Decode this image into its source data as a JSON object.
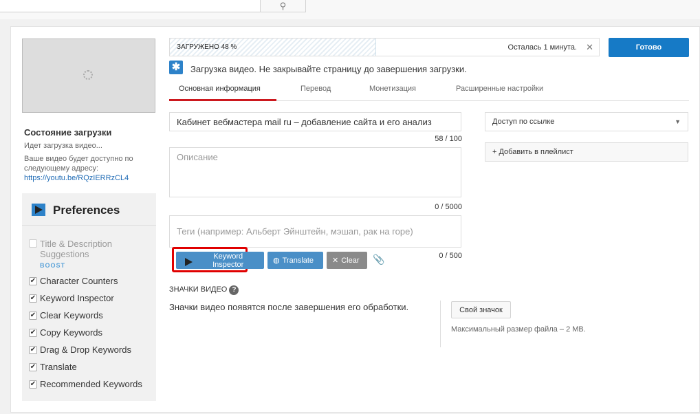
{
  "header": {
    "search_icon": "search-icon"
  },
  "sidebar": {
    "status_title": "Состояние загрузки",
    "status_text": "Идет загрузка видео...",
    "link_note_1": "Ваше видео будет доступно по",
    "link_note_2": "следующему адресу:",
    "link": "https://youtu.be/RQzIERRzCL4"
  },
  "prefs": {
    "title": "Preferences",
    "items": [
      {
        "label": "Title & Description",
        "label2": "Suggestions",
        "badge": "BOOST",
        "checked": false
      },
      {
        "label": "Character Counters",
        "checked": true
      },
      {
        "label": "Keyword Inspector",
        "checked": true
      },
      {
        "label": "Clear Keywords",
        "checked": true
      },
      {
        "label": "Copy Keywords",
        "checked": true
      },
      {
        "label": "Drag & Drop Keywords",
        "checked": true
      },
      {
        "label": "Translate",
        "checked": true
      },
      {
        "label": "Recommended Keywords",
        "checked": true
      }
    ]
  },
  "upload": {
    "progress_label": "ЗАГРУЖЕНО 48 %",
    "progress_percent": 48,
    "remaining": "Осталась 1 минута.",
    "done_label": "Готово",
    "notice": "Загрузка видео. Не закрывайте страницу до завершения загрузки."
  },
  "tabs": [
    {
      "label": "Основная информация",
      "active": true
    },
    {
      "label": "Перевод"
    },
    {
      "label": "Монетизация"
    },
    {
      "label": "Расширенные настройки"
    }
  ],
  "form": {
    "title_value": "Кабинет вебмастера mail ru – добавление сайта и его анализ",
    "title_count": "58 / 100",
    "description_placeholder": "Описание",
    "description_count": "0 / 5000",
    "tags_placeholder": "Теги (например: Альберт Эйнштейн, мэшап, рак на горе)",
    "tags_count": "0 / 500",
    "keyword_inspector": "Keyword Inspector",
    "translate": "Translate",
    "clear": "Clear",
    "privacy": "Доступ по ссылке",
    "playlist": "+ Добавить в плейлист"
  },
  "thumbs": {
    "title": "ЗНАЧКИ ВИДЕО",
    "note": "Значки видео появятся после завершения его обработки.",
    "custom": "Свой значок",
    "max_size": "Максимальный размер файла – 2 MB."
  },
  "colors": {
    "accent": "#167ac6",
    "tab_active": "#cc181e",
    "highlight": "#e00000"
  }
}
